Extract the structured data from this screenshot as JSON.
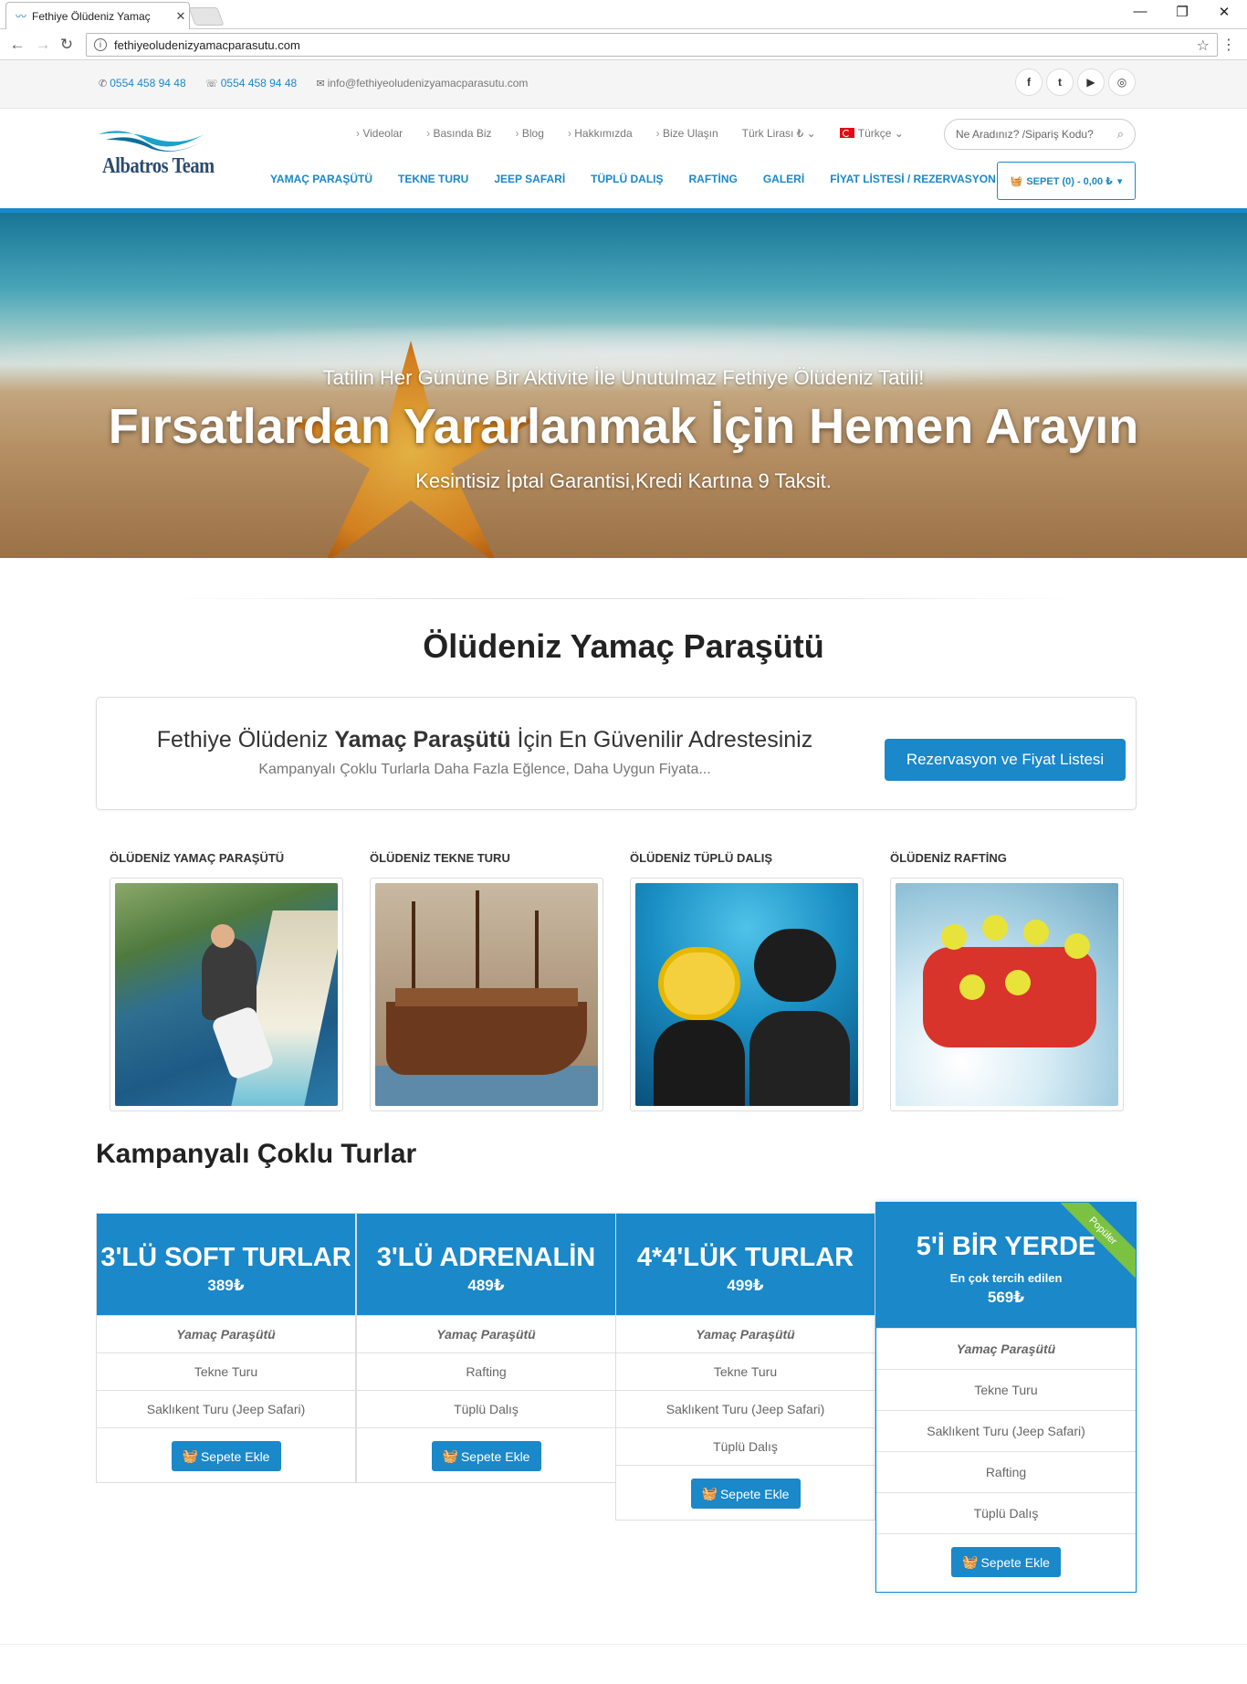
{
  "browser": {
    "tab_title": "Fethiye Ölüdeniz Yamaç",
    "tab_close": "✕",
    "url": "fethiyeoludenizyamacparasutu.com",
    "win_min": "—",
    "win_restore": "❐",
    "win_close": "✕"
  },
  "topbar": {
    "whatsapp": "0554 458 94 48",
    "phone": "0554 458 94 48",
    "email": "info@fethiyeoludenizyamacparasutu.com",
    "social": [
      "f",
      "t",
      "▶",
      "◎"
    ]
  },
  "header": {
    "logo_text": "Albatros Team",
    "top_links": [
      "Videolar",
      "Basında Biz",
      "Blog",
      "Hakkımızda",
      "Bize Ulaşın"
    ],
    "currency": "Türk Lirası ₺",
    "language": "Türkçe",
    "search_placeholder": "Ne Aradınız? /Sipariş Kodu?",
    "nav": [
      "YAMAÇ PARAŞÜTÜ",
      "TEKNE TURU",
      "JEEP SAFARİ",
      "TÜPLÜ DALIŞ",
      "RAFTİNG",
      "GALERİ",
      "FİYAT LİSTESİ / REZERVASYON"
    ],
    "cart": "SEPET (0) - 0,00 ₺"
  },
  "hero": {
    "line1": "Tatilin Her Gününe Bir Aktivite İle Unutulmaz Fethiye Ölüdeniz Tatili!",
    "line2": "Fırsatlardan Yararlanmak İçin Hemen Arayın",
    "line3": "Kesintisiz İptal Garantisi,Kredi Kartına 9 Taksit."
  },
  "section_title": "Ölüdeniz Yamaç Paraşütü",
  "cta": {
    "title_pre": "Fethiye Ölüdeniz ",
    "title_bold": "Yamaç Paraşütü",
    "title_post": " İçin En Güvenilir Adrestesiniz",
    "subtitle": "Kampanyalı Çoklu Turlarla Daha Fazla Eğlence, Daha Uygun Fiyata...",
    "button": "Rezervasyon ve Fiyat Listesi"
  },
  "activities": [
    {
      "label": "ÖLÜDENİZ YAMAÇ PARAŞÜTÜ"
    },
    {
      "label": "ÖLÜDENİZ TEKNE TURU"
    },
    {
      "label": "ÖLÜDENİZ TÜPLÜ DALIŞ"
    },
    {
      "label": "ÖLÜDENİZ RAFTİNG"
    }
  ],
  "campaign_title": "Kampanyalı Çoklu Turlar",
  "packages": [
    {
      "name": "3'LÜ SOFT TURLAR",
      "price": "389₺",
      "items": [
        "Yamaç Paraşütü",
        "Tekne Turu",
        "Saklıkent Turu (Jeep Safari)"
      ],
      "button": "Sepete Ekle"
    },
    {
      "name": "3'LÜ ADRENALİN",
      "price": "489₺",
      "items": [
        "Yamaç Paraşütü",
        "Rafting",
        "Tüplü Dalış"
      ],
      "button": "Sepete Ekle"
    },
    {
      "name": "4*4'LÜK TURLAR",
      "price": "499₺",
      "items": [
        "Yamaç Paraşütü",
        "Tekne Turu",
        "Saklıkent Turu (Jeep Safari)",
        "Tüplü Dalış"
      ],
      "button": "Sepete Ekle"
    },
    {
      "name": "5'İ BİR YERDE",
      "tagline": "En çok tercih edilen",
      "price": "569₺",
      "ribbon": "Popüler",
      "items": [
        "Yamaç Paraşütü",
        "Tekne Turu",
        "Saklıkent Turu (Jeep Safari)",
        "Rafting",
        "Tüplü Dalış"
      ],
      "button": "Sepete Ekle"
    }
  ],
  "colors": {
    "accent": "#1a88c9",
    "ribbon": "#7bc142"
  }
}
